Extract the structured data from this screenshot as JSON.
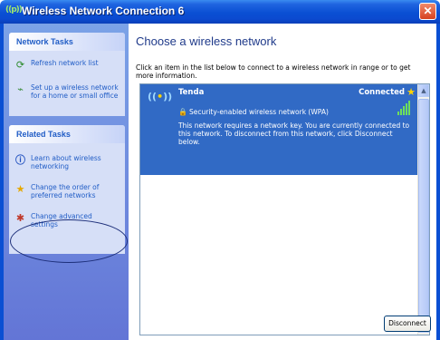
{
  "window": {
    "title": "Wireless Network Connection 6",
    "title_icon": "((p))",
    "close_glyph": "✕"
  },
  "sidebar": {
    "network_tasks": {
      "header": "Network Tasks",
      "items": [
        {
          "icon": "refresh-icon",
          "label": "Refresh network list"
        },
        {
          "icon": "setup-wireless-icon",
          "label": "Set up a wireless network for a home or small office"
        }
      ]
    },
    "related_tasks": {
      "header": "Related Tasks",
      "items": [
        {
          "icon": "info-icon",
          "label": "Learn about wireless networking"
        },
        {
          "icon": "star-icon",
          "label": "Change the order of preferred networks"
        },
        {
          "icon": "settings-icon",
          "label": "Change advanced settings"
        }
      ]
    }
  },
  "main": {
    "heading": "Choose a wireless network",
    "intro": "Click an item in the list below to connect to a wireless network in range or to get more information.",
    "networks": [
      {
        "name": "Tenda",
        "status": "Connected",
        "security": "Security-enabled wireless network (WPA)",
        "description": "This network requires a network key. You are currently connected to this network. To disconnect from this network, click Disconnect below.",
        "signal_bars": 5
      }
    ],
    "disconnect_label": "Disconnect"
  },
  "colors": {
    "titlebar": "#0a4fd3",
    "selection": "#316ac5",
    "task_link": "#215dc6"
  }
}
